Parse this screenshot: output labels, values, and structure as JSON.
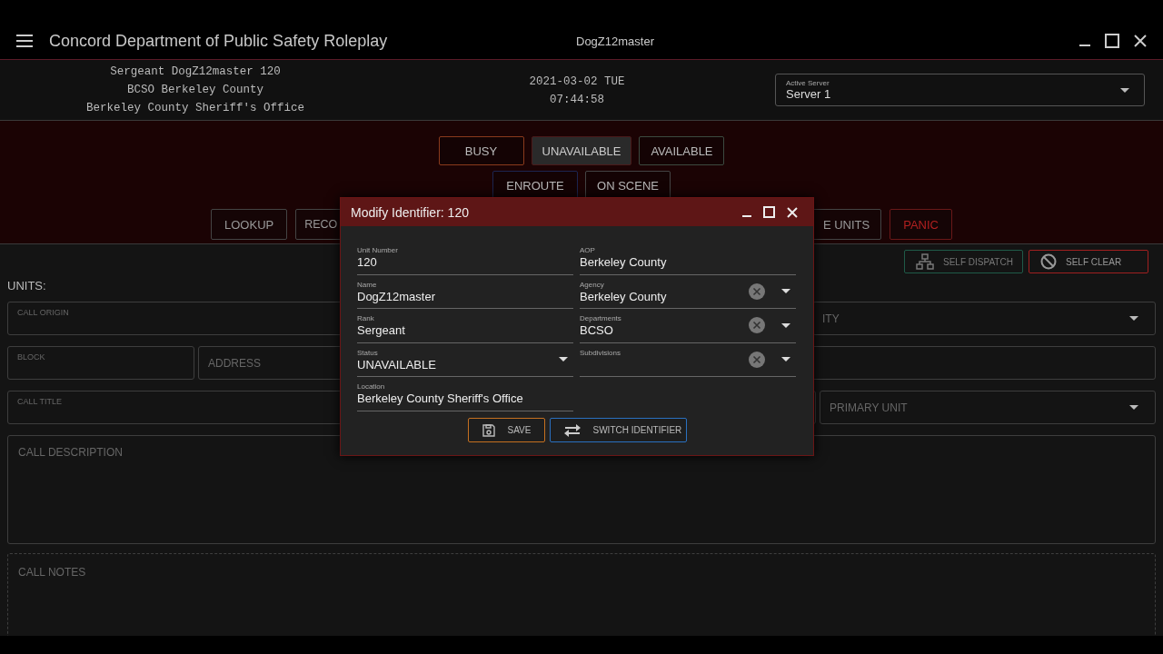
{
  "window": {
    "title": "Concord Department of Public Safety Roleplay",
    "user": "DogZ12master"
  },
  "header_info": {
    "lines": [
      "Sergeant DogZ12master 120",
      "BCSO Berkeley County",
      "Berkeley County Sheriff's Office"
    ],
    "date": "2021-03-02 TUE",
    "time": "07:44:58"
  },
  "server_select": {
    "label": "Active Server",
    "value": "Server 1"
  },
  "status_rows": [
    [
      {
        "label": "BUSY",
        "selected": false,
        "color": "#8a3a1c"
      },
      {
        "label": "UNAVAILABLE",
        "selected": true,
        "color": "#4a1a1a"
      },
      {
        "label": "AVAILABLE",
        "selected": false,
        "color": "#3c4a40"
      }
    ],
    [
      {
        "label": "ENROUTE",
        "selected": false,
        "color": "#1c2550"
      },
      {
        "label": "ON SCENE",
        "selected": false,
        "color": "#444444"
      }
    ]
  ],
  "action_buttons": [
    {
      "label": "LOOKUP",
      "kind": "normal"
    },
    {
      "label": "RECO",
      "kind": "normal"
    },
    {
      "label": "E UNITS",
      "kind": "normal"
    },
    {
      "label": "PANIC",
      "kind": "panic"
    }
  ],
  "call_actions": [
    {
      "label": "SELF DISPATCH",
      "kind": "dispatch",
      "color": "#1f5a48"
    },
    {
      "label": "SELF CLEAR",
      "kind": "clear",
      "color": "#a02020"
    }
  ],
  "units_label": "UNITS:",
  "call_form": {
    "rows": [
      [
        {
          "label": "CALL ORIGIN",
          "kind": "labeled"
        },
        {
          "label": "ITY",
          "kind": "select"
        }
      ],
      [
        {
          "label": "BLOCK",
          "kind": "labeled"
        },
        {
          "label": "ADDRESS",
          "kind": "plain"
        },
        {
          "kind": "empty"
        }
      ],
      [
        {
          "label": "CALL TITLE",
          "kind": "labeled"
        },
        {
          "label": "PRIMARY UNIT",
          "kind": "select"
        }
      ]
    ],
    "description": "CALL DESCRIPTION",
    "notes": "CALL NOTES"
  },
  "dialog": {
    "title": "Modify Identifier: 120",
    "left_fields": [
      {
        "label": "Unit Number",
        "value": "120",
        "kind": "text"
      },
      {
        "label": "Name",
        "value": "DogZ12master",
        "kind": "text"
      },
      {
        "label": "Rank",
        "value": "Sergeant",
        "kind": "text"
      },
      {
        "label": "Status",
        "value": "UNAVAILABLE",
        "kind": "select"
      },
      {
        "label": "Location",
        "value": "Berkeley County Sheriff's Office",
        "kind": "text"
      }
    ],
    "right_fields": [
      {
        "label": "AOP",
        "value": "Berkeley County",
        "kind": "text"
      },
      {
        "label": "Agency",
        "value": "Berkeley County",
        "kind": "clearable"
      },
      {
        "label": "Departments",
        "value": "BCSO",
        "kind": "clearable"
      },
      {
        "label": "Subdivisions",
        "kind": "clearable"
      }
    ],
    "buttons": [
      {
        "label": "SAVE",
        "kind": "save"
      },
      {
        "label": "SWITCH IDENTIFIER",
        "kind": "switch"
      }
    ]
  }
}
